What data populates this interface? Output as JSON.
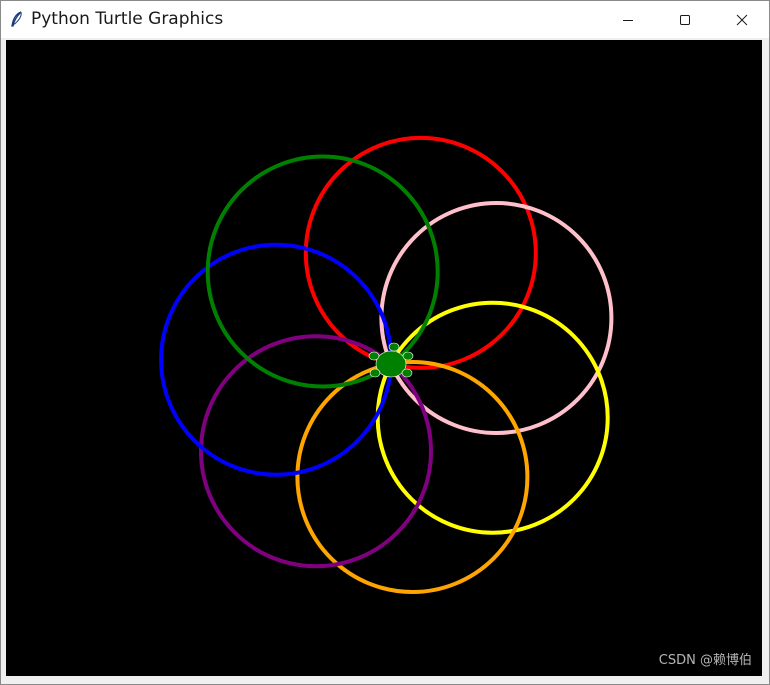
{
  "window": {
    "title": "Python Turtle Graphics",
    "controls": {
      "minimize": "minimize-icon",
      "maximize": "maximize-icon",
      "close": "close-icon"
    }
  },
  "canvas": {
    "background": "#000000",
    "circle_colors": [
      "#ff0000",
      "#ffc0cb",
      "#ffff00",
      "#ffa500",
      "#800080",
      "#0000ff",
      "#008000"
    ],
    "turtle_color": "#008000"
  },
  "watermark": {
    "text": "CSDN @赖博伯"
  }
}
